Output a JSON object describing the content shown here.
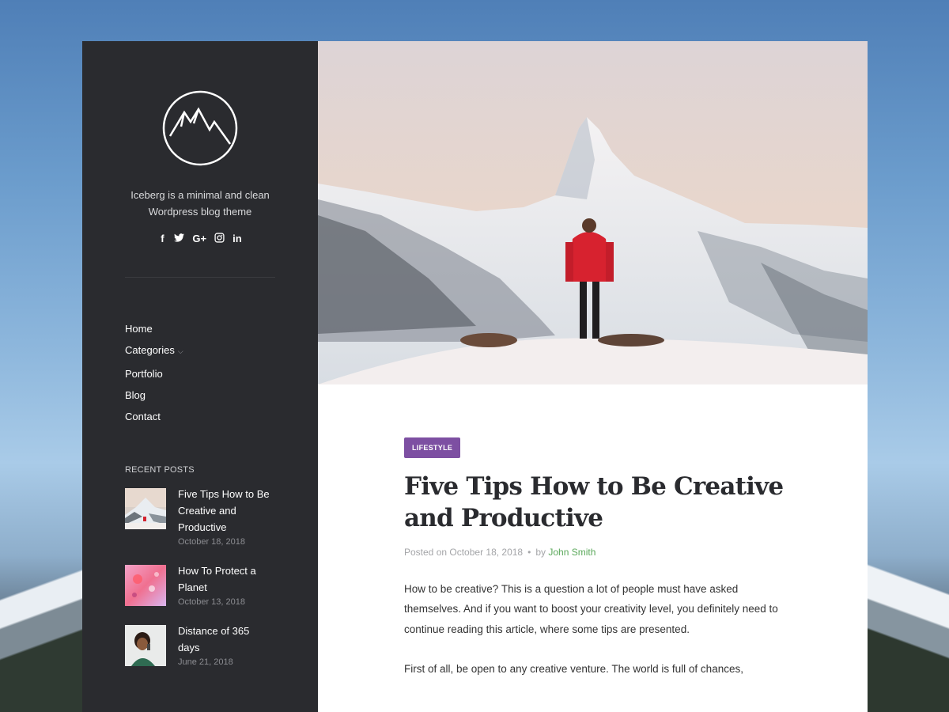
{
  "sidebar": {
    "tagline_line1": "Iceberg is a minimal and clean",
    "tagline_line2": "Wordpress blog theme",
    "social": [
      {
        "icon": "facebook-icon",
        "glyph": "f"
      },
      {
        "icon": "twitter-icon",
        "glyph": "t"
      },
      {
        "icon": "google-plus-icon",
        "glyph": "G+"
      },
      {
        "icon": "instagram-icon",
        "glyph": "◎"
      },
      {
        "icon": "linkedin-icon",
        "glyph": "in"
      }
    ],
    "nav": [
      "Home",
      "Categories",
      "Portfolio",
      "Blog",
      "Contact"
    ],
    "recent_title": "RECENT POSTS",
    "recent_posts": [
      {
        "title_line1": "Five Tips How to Be",
        "title_line2": "Creative and",
        "title_line3": "Productive",
        "date": "October 18, 2018"
      },
      {
        "title_line1": "How To Protect a",
        "title_line2": "Planet",
        "date": "October 13, 2018"
      },
      {
        "title_line1": "Distance of 365",
        "title_line2": "days",
        "date": "June 21, 2018"
      }
    ]
  },
  "article": {
    "category": "LIFESTYLE",
    "title_line1": "Five Tips How to Be Creative",
    "title_line2": "and Productive",
    "posted_label": "Posted on October 18, 2018",
    "by_label": "by",
    "author": "John Smith",
    "para1": "How to be creative? This is a question a lot of people must have asked themselves. And if you want to boost your creativity level, you definitely need to continue reading this article, where some tips are presented.",
    "para2": "First of all, be open to any creative venture. The world is full of chances,"
  },
  "colors": {
    "sidebar_bg": "#2a2b2f",
    "badge": "#7d4fa2",
    "author_link": "#5aa85a"
  }
}
